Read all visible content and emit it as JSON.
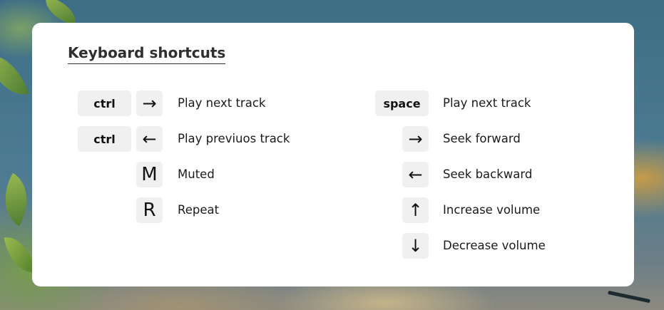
{
  "dialog": {
    "title": "Keyboard shortcuts"
  },
  "left_shortcuts": [
    {
      "modifier": "ctrl",
      "key": "→",
      "key_icon": "arrow-right-icon",
      "action": "Play next track"
    },
    {
      "modifier": "ctrl",
      "key": "←",
      "key_icon": "arrow-left-icon",
      "action": "Play previuos track"
    },
    {
      "modifier": "",
      "key": "M",
      "action": "Muted"
    },
    {
      "modifier": "",
      "key": "R",
      "action": "Repeat"
    }
  ],
  "right_shortcuts": [
    {
      "modifier": "space",
      "key": "",
      "action": "Play next track"
    },
    {
      "modifier": "",
      "key": "→",
      "key_icon": "arrow-right-icon",
      "action": "Seek forward"
    },
    {
      "modifier": "",
      "key": "←",
      "key_icon": "arrow-left-icon",
      "action": "Seek backward"
    },
    {
      "modifier": "",
      "key": "↑",
      "key_icon": "arrow-up-icon",
      "action": "Increase volume"
    },
    {
      "modifier": "",
      "key": "↓",
      "key_icon": "arrow-down-icon",
      "action": "Decrease volume"
    }
  ],
  "colors": {
    "card_background": "#ffffff",
    "key_background": "#f0f0f0",
    "text": "#1a1a1a"
  }
}
